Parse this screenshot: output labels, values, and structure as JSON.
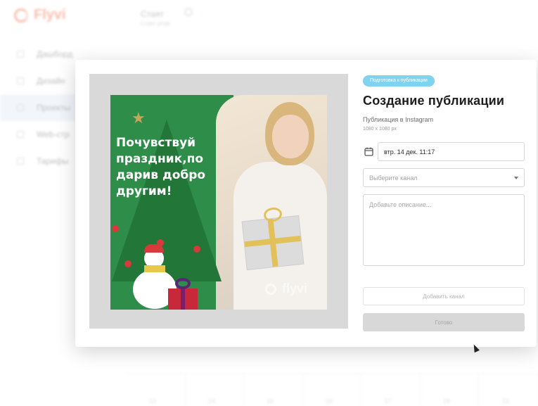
{
  "background": {
    "logo_text": "Flyvi",
    "switcher": {
      "label": "Стаят",
      "sublabel": "Стаят proje"
    },
    "nav": [
      {
        "label": "Дашборд"
      },
      {
        "label": "Дизайн"
      },
      {
        "label": "Проекты"
      },
      {
        "label": "Web-стр"
      },
      {
        "label": "Тарифы"
      }
    ],
    "calendar_days": [
      "13",
      "14",
      "15",
      "16",
      "17",
      "18",
      "19"
    ]
  },
  "modal": {
    "status_badge": "Подготовка к публикации",
    "title": "Создание публикации",
    "subtitle": "Публикация в Instagram",
    "size": "1080 x 1080 px",
    "date_value": "втр. 14 дек. 11:17",
    "channel_placeholder": "Выберите канал",
    "description_placeholder": "Добавьте описание...",
    "add_channel_label": "Добавить канал",
    "submit_label": "Готово"
  },
  "preview": {
    "headline": "Почувствуй\nпраздник,по\nдарив добро\nдругим!",
    "watermark": "flyvi"
  },
  "colors": {
    "green": "#2f8d4a",
    "badge": "#7fd3ee",
    "brand": "#f08a6c"
  }
}
